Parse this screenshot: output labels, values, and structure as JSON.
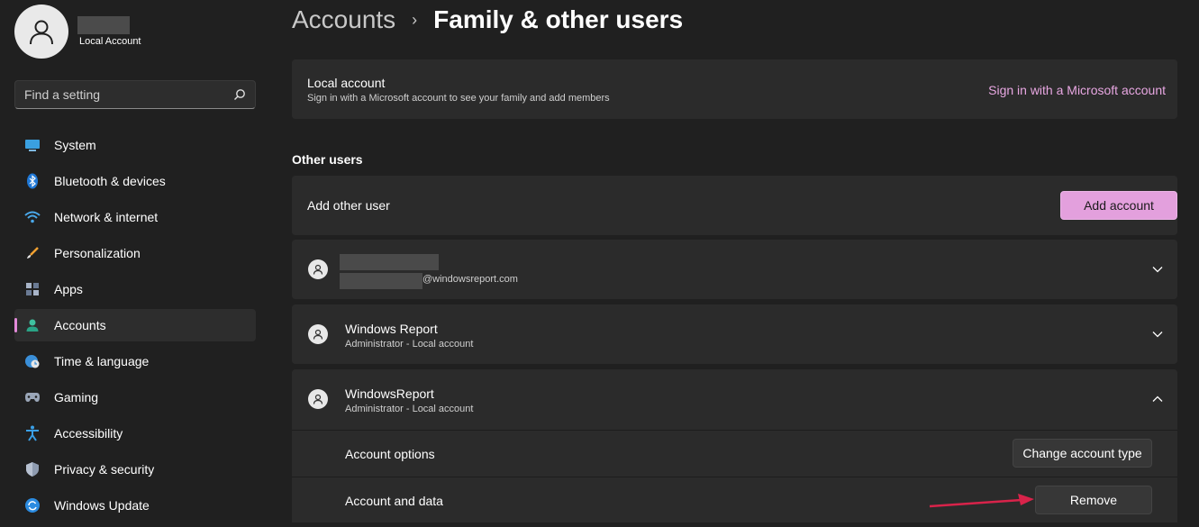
{
  "profile": {
    "account_type": "Local Account"
  },
  "search": {
    "placeholder": "Find a setting"
  },
  "nav": {
    "items": [
      {
        "label": "System",
        "icon": "monitor-icon"
      },
      {
        "label": "Bluetooth & devices",
        "icon": "bluetooth-icon"
      },
      {
        "label": "Network & internet",
        "icon": "wifi-icon"
      },
      {
        "label": "Personalization",
        "icon": "brush-icon"
      },
      {
        "label": "Apps",
        "icon": "apps-icon"
      },
      {
        "label": "Accounts",
        "icon": "person-icon"
      },
      {
        "label": "Time & language",
        "icon": "globe-clock-icon"
      },
      {
        "label": "Gaming",
        "icon": "gamepad-icon"
      },
      {
        "label": "Accessibility",
        "icon": "accessibility-icon"
      },
      {
        "label": "Privacy & security",
        "icon": "shield-icon"
      },
      {
        "label": "Windows Update",
        "icon": "update-icon"
      }
    ],
    "active": "Accounts"
  },
  "header": {
    "parent": "Accounts",
    "separator": "›",
    "current": "Family & other users"
  },
  "local_account": {
    "title": "Local account",
    "description": "Sign in with a Microsoft account to see your family and add members",
    "link": "Sign in with a Microsoft account"
  },
  "other_users": {
    "label": "Other users",
    "add_label": "Add other user",
    "add_button": "Add account",
    "users": [
      {
        "email_suffix": "@windowsreport.com"
      },
      {
        "name": "Windows Report",
        "role": "Administrator - Local account"
      },
      {
        "name": "WindowsReport",
        "role": "Administrator - Local account"
      }
    ],
    "options": {
      "account_options_label": "Account options",
      "change_type_button": "Change account type",
      "account_data_label": "Account and data",
      "remove_button": "Remove"
    }
  },
  "colors": {
    "accent": "#e3a0dd",
    "link": "#e8a7e2",
    "background": "#202020",
    "card": "#2b2b2b",
    "arrow": "#d8234a"
  }
}
